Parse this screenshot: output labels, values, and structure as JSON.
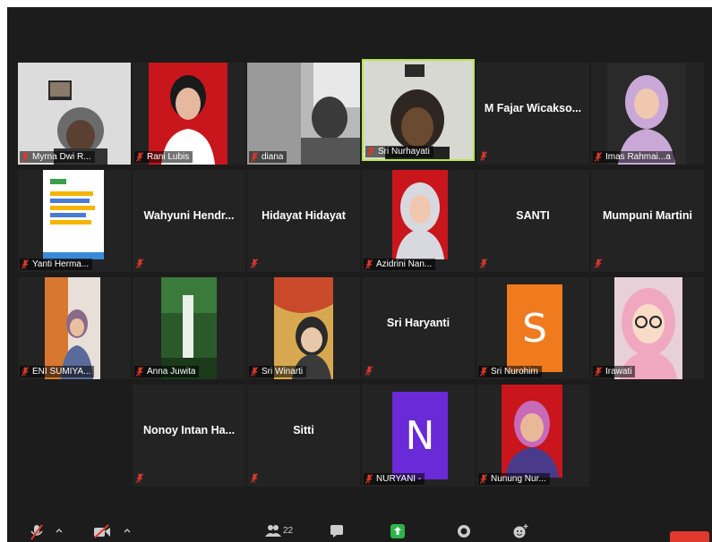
{
  "participants": [
    {
      "name_label": "Myrna Dwi R...",
      "video": true
    },
    {
      "name_label": "Rani Lubis",
      "video": true
    },
    {
      "name_label": "diana",
      "video": true
    },
    {
      "name_label": "Sri Nurhayati",
      "video": true,
      "active_speaker": true
    },
    {
      "display_name": "M Fajar Wicakso...",
      "video": false
    },
    {
      "name_label": "Imas Rahmai...a",
      "video": true
    },
    {
      "name_label": "Yanti Herma...",
      "video": true
    },
    {
      "display_name": "Wahyuni Hendr...",
      "video": false
    },
    {
      "display_name": "Hidayat Hidayat",
      "video": false
    },
    {
      "name_label": "Azidrini Nan...",
      "video": true
    },
    {
      "display_name": "SANTI",
      "video": false
    },
    {
      "display_name": "Mumpuni Martini",
      "video": false
    },
    {
      "name_label": "ENI SUMIYA...",
      "video": true
    },
    {
      "name_label": "Anna Juwita",
      "video": true
    },
    {
      "name_label": "Sri Winarti",
      "video": true
    },
    {
      "display_name": "Sri Haryanti",
      "video": false
    },
    {
      "name_label": "Sri Nurohim",
      "avatar_initial": "S",
      "avatar_color": "#f07a1e"
    },
    {
      "name_label": "Irawati",
      "video": true
    },
    {
      "display_name": "Nonoy Intan Ha...",
      "video": false
    },
    {
      "display_name": "Sitti",
      "video": false
    },
    {
      "name_label": "NURYANI -",
      "avatar_initial": "N",
      "avatar_color": "#6a2ad8"
    },
    {
      "name_label": "Nunung Nur...",
      "video": true
    }
  ],
  "toolbar": {
    "participants_count": "22",
    "icons": [
      "microphone-muted-icon",
      "video-off-icon",
      "participants-icon",
      "chat-icon",
      "share-screen-icon",
      "record-icon",
      "reactions-icon",
      "end-button"
    ]
  },
  "colors": {
    "background": "#1c1c1c",
    "tile": "#232323",
    "active_border": "#b8e64a",
    "muted_icon": "#e0382c",
    "share_green": "#2db34a",
    "end_red": "#e0382c"
  }
}
